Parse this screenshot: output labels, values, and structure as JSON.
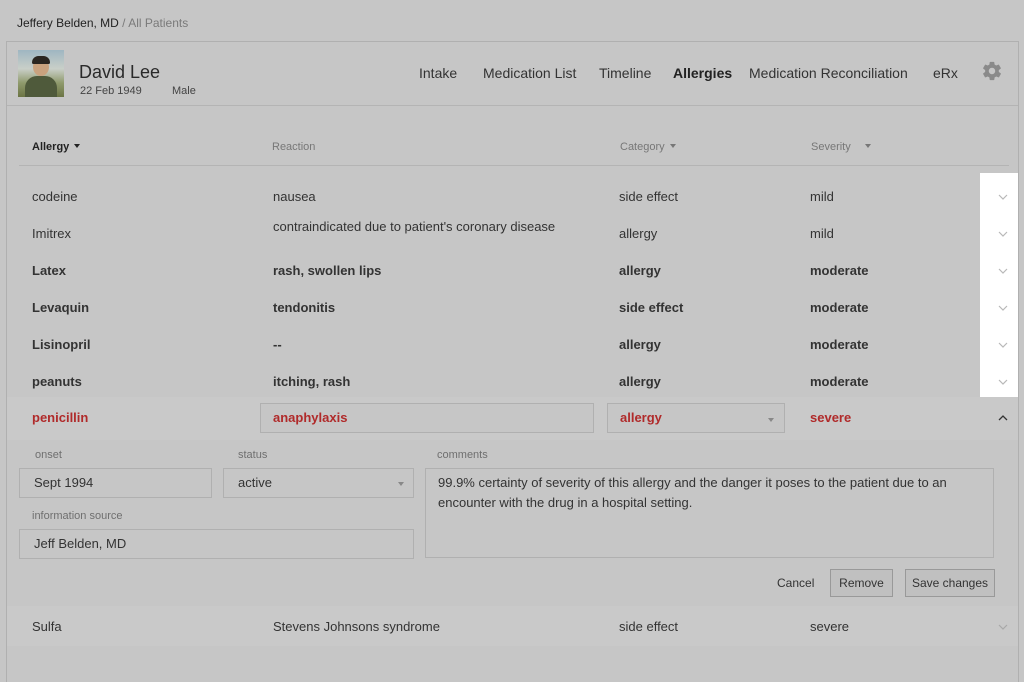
{
  "breadcrumb": {
    "doctor": "Jeffery Belden, MD",
    "separator": "/",
    "all": "All Patients"
  },
  "patient": {
    "name": "David Lee",
    "dob": "22 Feb 1949",
    "sex": "Male"
  },
  "nav": {
    "intake": "Intake",
    "medication_list": "Medication List",
    "timeline": "Timeline",
    "allergies": "Allergies",
    "med_rec": "Medication Reconciliation",
    "erx": "eRx",
    "active": "Allergies"
  },
  "columns": {
    "allergy": "Allergy",
    "reaction": "Reaction",
    "category": "Category",
    "severity": "Severity"
  },
  "rows": [
    {
      "allergy": "codeine",
      "reaction": "nausea",
      "category": "side effect",
      "severity": "mild"
    },
    {
      "allergy": "Imitrex",
      "reaction": "contraindicated due to patient's coronary disease",
      "category": "allergy",
      "severity": "mild"
    },
    {
      "allergy": "Latex",
      "reaction": "rash, swollen lips",
      "category": "allergy",
      "severity": "moderate"
    },
    {
      "allergy": "Levaquin",
      "reaction": "tendonitis",
      "category": "side effect",
      "severity": "moderate"
    },
    {
      "allergy": "Lisinopril",
      "reaction": "--",
      "category": "allergy",
      "severity": "moderate"
    },
    {
      "allergy": "peanuts",
      "reaction": "itching, rash",
      "category": "allergy",
      "severity": "moderate"
    },
    {
      "allergy": "penicillin",
      "reaction": "anaphylaxis",
      "category": "allergy",
      "severity": "severe"
    },
    {
      "allergy": "Sulfa",
      "reaction": "Stevens Johnsons syndrome",
      "category": "side effect",
      "severity": "severe"
    }
  ],
  "detail": {
    "onset_label": "onset",
    "onset_value": "Sept 1994",
    "status_label": "status",
    "status_value": "active",
    "source_label": "information source",
    "source_value": "Jeff Belden, MD",
    "comments_label": "comments",
    "comments_value": "99.9% certainty of severity of this allergy and the danger it poses to the patient due to an encounter with the drug in a hospital setting.",
    "cancel": "Cancel",
    "remove": "Remove",
    "save": "Save changes"
  },
  "colors": {
    "severe_red": "#b02a2a",
    "background": "#c6c6c6",
    "chevron_column": "#ffffff"
  }
}
